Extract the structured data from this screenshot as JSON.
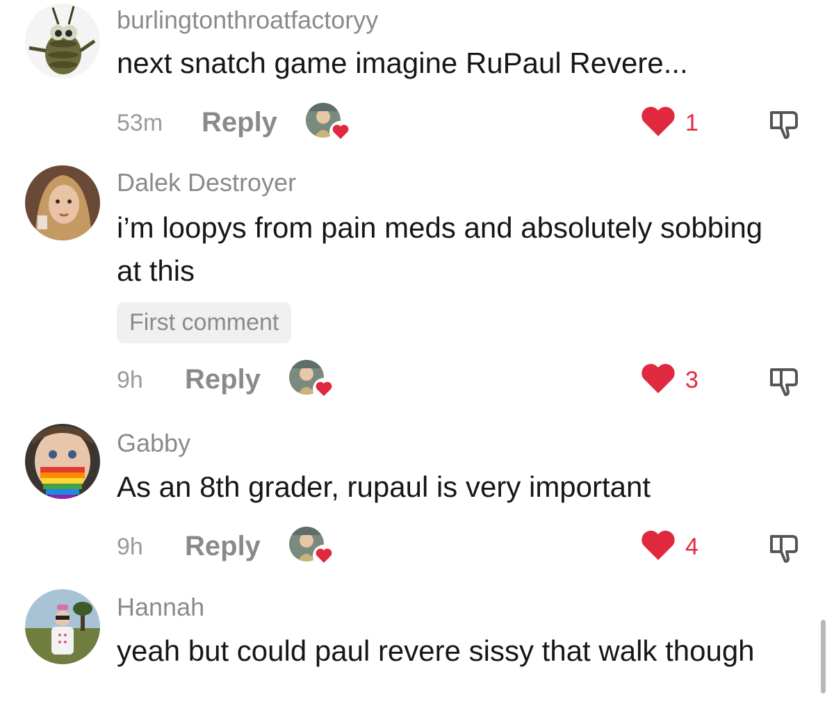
{
  "comments": [
    {
      "username": "burlingtonthroatfactoryy",
      "text": "next snatch game imagine RuPaul Revere...",
      "time": "53m",
      "reply_label": "Reply",
      "likes": "1",
      "avatar_icon": "cartoon-bug-avatar",
      "liked_by_creator": true
    },
    {
      "username": "Dalek Destroyer",
      "text": "i’m loopys from pain meds and absolutely sobbing at this",
      "badge": "First comment",
      "time": "9h",
      "reply_label": "Reply",
      "likes": "3",
      "avatar_icon": "woman-portrait-avatar",
      "liked_by_creator": true
    },
    {
      "username": "Gabby",
      "text": "As an 8th grader, rupaul is very important",
      "time": "9h",
      "reply_label": "Reply",
      "likes": "4",
      "avatar_icon": "rainbow-beard-avatar",
      "liked_by_creator": true
    },
    {
      "username": "Hannah",
      "text": "yeah but could paul revere sissy that walk though",
      "avatar_icon": "child-outdoors-avatar"
    }
  ],
  "colors": {
    "like_red": "#e0283f",
    "username_gray": "#8a8a8a",
    "text_black": "#161616",
    "badge_bg": "#f0f0f0"
  }
}
